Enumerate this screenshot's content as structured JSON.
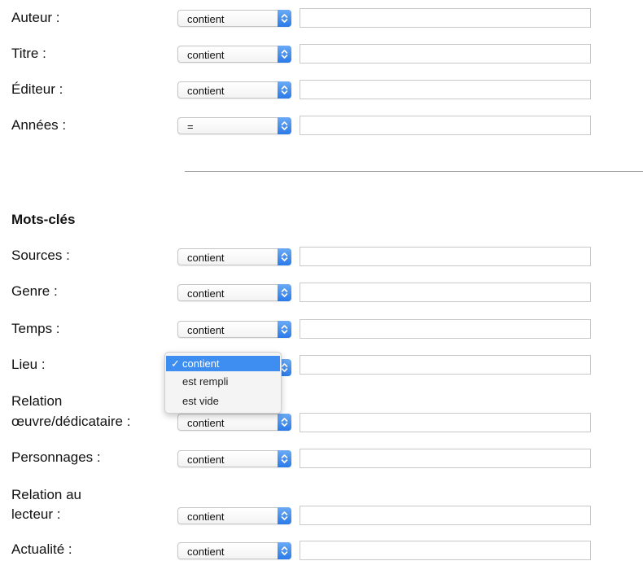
{
  "fields_top": [
    {
      "label": "Auteur :",
      "operator": "contient",
      "value": ""
    },
    {
      "label": "Titre :",
      "operator": "contient",
      "value": ""
    },
    {
      "label": "Éditeur :",
      "operator": "contient",
      "value": ""
    },
    {
      "label": "Années :",
      "operator": "=",
      "value": ""
    }
  ],
  "keywords_section": {
    "heading": "Mots-clés",
    "fields": [
      {
        "label": "Sources :",
        "operator": "contient",
        "value": ""
      },
      {
        "label": "Genre :",
        "operator": "contient",
        "value": ""
      },
      {
        "label": "Temps :",
        "operator": "contient",
        "value": ""
      },
      {
        "label": "Lieu :",
        "operator": "contient",
        "value": ""
      },
      {
        "label_line1": "Relation",
        "label_line2": "œuvre/dédicataire :",
        "operator": "contient",
        "value": ""
      },
      {
        "label": "Personnages :",
        "operator": "contient",
        "value": ""
      },
      {
        "label_line1": "Relation au",
        "label_line2": "lecteur :",
        "operator": "contient",
        "value": ""
      },
      {
        "label": "Actualité :",
        "operator": "contient",
        "value": ""
      }
    ]
  },
  "open_dropdown": {
    "options": [
      "contient",
      "est rempli",
      "est vide"
    ],
    "selected_index": 0,
    "check_glyph": "✓"
  },
  "colors": {
    "accent": "#3d8ef0",
    "divider": "#9a9a9a"
  }
}
